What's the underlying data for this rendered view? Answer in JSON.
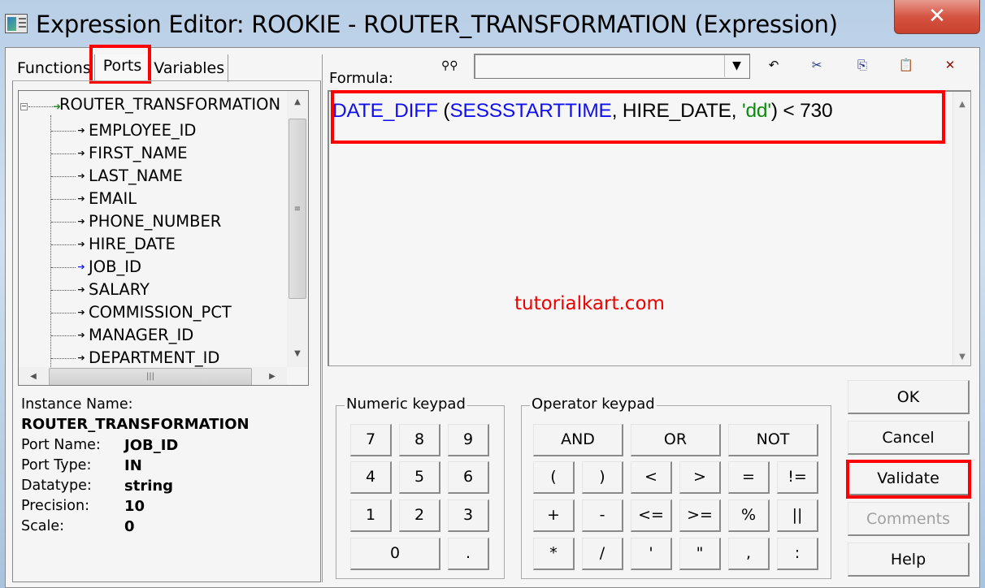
{
  "window": {
    "title": "Expression Editor: ROOKIE - ROUTER_TRANSFORMATION (Expression)",
    "close_icon": "close-icon"
  },
  "left_panel": {
    "tabs": [
      {
        "label": "Functions",
        "active": false
      },
      {
        "label": "Ports",
        "active": true,
        "highlighted": true
      },
      {
        "label": "Variables",
        "active": false
      }
    ],
    "tree": {
      "root": {
        "label": "ROUTER_TRANSFORMATION",
        "icon": "transformation-icon",
        "expanded": true
      },
      "items": [
        {
          "label": "EMPLOYEE_ID",
          "icon": "input-port-arrow-icon",
          "selected": false
        },
        {
          "label": "FIRST_NAME",
          "icon": "input-port-arrow-icon",
          "selected": false
        },
        {
          "label": "LAST_NAME",
          "icon": "input-port-arrow-icon",
          "selected": false
        },
        {
          "label": "EMAIL",
          "icon": "input-port-arrow-icon",
          "selected": false
        },
        {
          "label": "PHONE_NUMBER",
          "icon": "input-port-arrow-icon",
          "selected": false
        },
        {
          "label": "HIRE_DATE",
          "icon": "input-port-arrow-icon",
          "selected": false
        },
        {
          "label": "JOB_ID",
          "icon": "input-port-arrow-icon",
          "selected": true
        },
        {
          "label": "SALARY",
          "icon": "input-port-arrow-icon",
          "selected": false
        },
        {
          "label": "COMMISSION_PCT",
          "icon": "input-port-arrow-icon",
          "selected": false
        },
        {
          "label": "MANAGER_ID",
          "icon": "input-port-arrow-icon",
          "selected": false
        },
        {
          "label": "DEPARTMENT_ID",
          "icon": "input-port-arrow-icon",
          "selected": false
        }
      ]
    },
    "info": {
      "instance_name_label": "Instance Name:",
      "instance_name_value": "ROUTER_TRANSFORMATION",
      "rows": [
        {
          "key": "Port Name:",
          "value": "JOB_ID"
        },
        {
          "key": "Port Type:",
          "value": "IN"
        },
        {
          "key": "Datatype:",
          "value": "string"
        },
        {
          "key": "Precision:",
          "value": "10"
        },
        {
          "key": "Scale:",
          "value": "0"
        }
      ]
    }
  },
  "toolbar": {
    "find_icon": "binoculars-icon",
    "search_combo_value": "",
    "icons": [
      "undo-icon",
      "cut-icon",
      "copy-icon",
      "paste-icon",
      "delete-icon"
    ]
  },
  "formula": {
    "label": "Formula:",
    "tokens": [
      {
        "text": "DATE_DIFF",
        "kind": "fn"
      },
      {
        "text": " (",
        "kind": "plain"
      },
      {
        "text": "SESSSTARTTIME",
        "kind": "fn"
      },
      {
        "text": ", HIRE_DATE, ",
        "kind": "plain"
      },
      {
        "text": "'dd'",
        "kind": "str"
      },
      {
        "text": ") < 730",
        "kind": "plain"
      }
    ],
    "full_text": "DATE_DIFF (SESSSTARTTIME, HIRE_DATE, 'dd') < 730",
    "watermark": "tutorialkart.com",
    "colors": {
      "function": "#1010ee",
      "string": "#0d8a0d",
      "watermark": "#ee0000",
      "highlight": "#ff0000"
    }
  },
  "numeric_keypad": {
    "legend": "Numeric keypad",
    "keys": [
      "7",
      "8",
      "9",
      "4",
      "5",
      "6",
      "1",
      "2",
      "3",
      "0",
      "."
    ]
  },
  "operator_keypad": {
    "legend": "Operator keypad",
    "logic_keys": [
      "AND",
      "OR",
      "NOT"
    ],
    "keys": [
      "(",
      ")",
      "<",
      ">",
      "=",
      "!=",
      "+",
      "-",
      "<=",
      ">=",
      "%",
      "||",
      "*",
      "/",
      "'",
      "\"",
      ",",
      ":"
    ]
  },
  "buttons": {
    "ok": "OK",
    "cancel": "Cancel",
    "validate": "Validate",
    "comments": "Comments",
    "help": "Help"
  }
}
